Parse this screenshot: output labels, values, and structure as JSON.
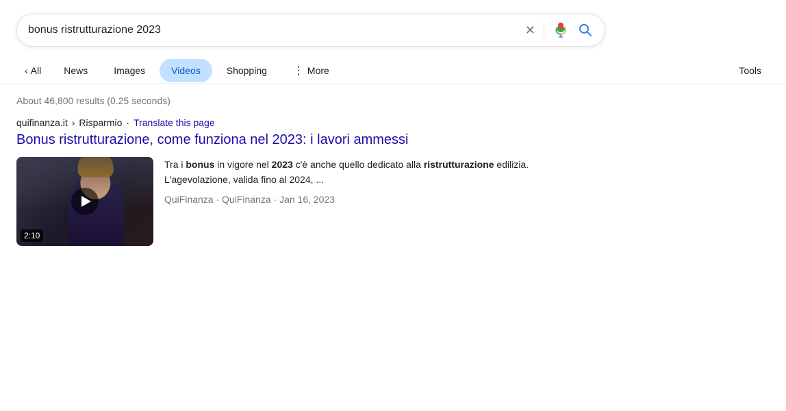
{
  "search": {
    "query": "bonus ristrutturazione 2023",
    "clear_label": "×",
    "voice_label": "Search by voice",
    "submit_label": "Google Search"
  },
  "tabs": {
    "back_label": "All",
    "items": [
      {
        "id": "news",
        "label": "News",
        "active": false
      },
      {
        "id": "images",
        "label": "Images",
        "active": false
      },
      {
        "id": "videos",
        "label": "Videos",
        "active": true
      },
      {
        "id": "shopping",
        "label": "Shopping",
        "active": false
      },
      {
        "id": "more",
        "label": "More",
        "active": false,
        "has_dots": true
      }
    ],
    "tools_label": "Tools"
  },
  "results_info": "About 46,800 results (0.25 seconds)",
  "result": {
    "site": "quifinanza.it",
    "separator": "›",
    "path": "Risparmio",
    "dot": "·",
    "translate_label": "Translate this page",
    "title": "Bonus ristrutturazione, come funziona nel 2023: i lavori ammessi",
    "snippet_html": "Tra i <b>bonus</b> in vigore nel <b>2023</b> c'è anche quello dedicato alla <b>ristrutturazione</b> edilizia. L'agevolazione, valida fino al 2024, ...",
    "meta": "QuiFinanza · QuiFinanza · Jan 16, 2023",
    "video": {
      "duration": "2:10"
    }
  }
}
